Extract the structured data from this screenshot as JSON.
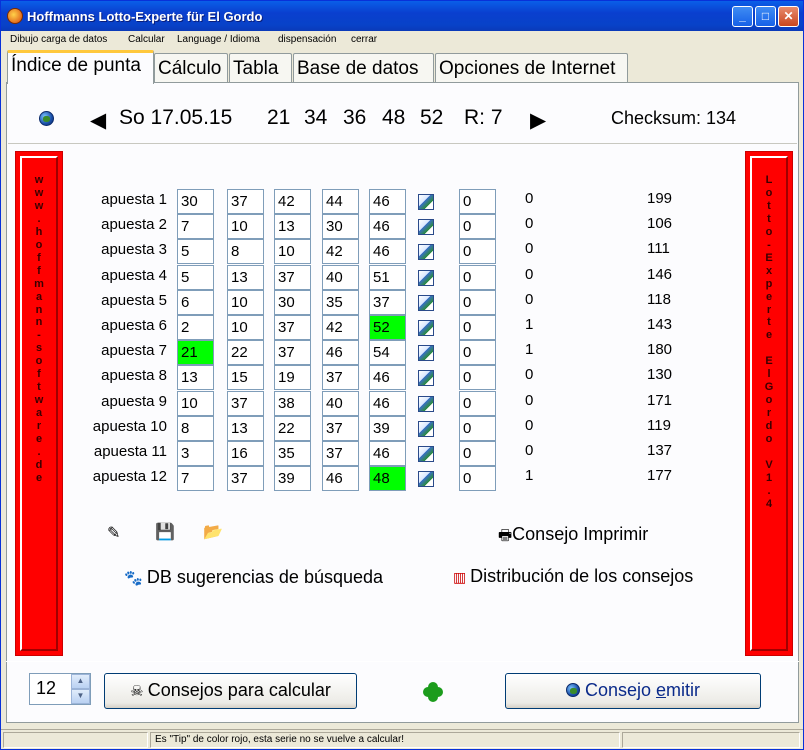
{
  "window": {
    "title": "Hoffmanns Lotto-Experte  für El Gordo",
    "min": "_",
    "max": "□",
    "close": "✕"
  },
  "menu": [
    "Dibujo carga de datos",
    "Calcular",
    "Language / Idioma",
    "dispensación",
    "cerrar"
  ],
  "tabs": [
    "Índice de punta",
    "Cálculo",
    "Tabla",
    "Base de datos",
    "Opciones de Internet"
  ],
  "draw": {
    "date": "So 17.05.15",
    "numbers": [
      "21",
      "34",
      "36",
      "48",
      "52"
    ],
    "r": "R: 7",
    "checksum": "Checksum: 134"
  },
  "left_sidebar": "www.hoffmann-software.de",
  "right_sidebar": "Lotto-Experte ElGordo V1.4",
  "bets": [
    {
      "label": "apuesta 1",
      "nums": [
        "30",
        "37",
        "42",
        "44",
        "46"
      ],
      "green": [],
      "field": "0",
      "hits": "0",
      "score": "199"
    },
    {
      "label": "apuesta 2",
      "nums": [
        "7",
        "10",
        "13",
        "30",
        "46"
      ],
      "green": [],
      "field": "0",
      "hits": "0",
      "score": "106"
    },
    {
      "label": "apuesta 3",
      "nums": [
        "5",
        "8",
        "10",
        "42",
        "46"
      ],
      "green": [],
      "field": "0",
      "hits": "0",
      "score": "111"
    },
    {
      "label": "apuesta 4",
      "nums": [
        "5",
        "13",
        "37",
        "40",
        "51"
      ],
      "green": [],
      "field": "0",
      "hits": "0",
      "score": "146"
    },
    {
      "label": "apuesta 5",
      "nums": [
        "6",
        "10",
        "30",
        "35",
        "37"
      ],
      "green": [],
      "field": "0",
      "hits": "0",
      "score": "118"
    },
    {
      "label": "apuesta 6",
      "nums": [
        "2",
        "10",
        "37",
        "42",
        "52"
      ],
      "green": [
        4
      ],
      "field": "0",
      "hits": "1",
      "score": "143"
    },
    {
      "label": "apuesta 7",
      "nums": [
        "21",
        "22",
        "37",
        "46",
        "54"
      ],
      "green": [
        0
      ],
      "field": "0",
      "hits": "1",
      "score": "180"
    },
    {
      "label": "apuesta 8",
      "nums": [
        "13",
        "15",
        "19",
        "37",
        "46"
      ],
      "green": [],
      "field": "0",
      "hits": "0",
      "score": "130"
    },
    {
      "label": "apuesta 9",
      "nums": [
        "10",
        "37",
        "38",
        "40",
        "46"
      ],
      "green": [],
      "field": "0",
      "hits": "0",
      "score": "171"
    },
    {
      "label": "apuesta 10",
      "nums": [
        "8",
        "13",
        "22",
        "37",
        "39"
      ],
      "green": [],
      "field": "0",
      "hits": "0",
      "score": "119"
    },
    {
      "label": "apuesta 11",
      "nums": [
        "3",
        "16",
        "35",
        "37",
        "46"
      ],
      "green": [],
      "field": "0",
      "hits": "0",
      "score": "137"
    },
    {
      "label": "apuesta 12",
      "nums": [
        "7",
        "37",
        "39",
        "46",
        "48"
      ],
      "green": [
        4
      ],
      "field": "0",
      "hits": "1",
      "score": "177"
    }
  ],
  "actions": {
    "print": "Consejo Imprimir",
    "db_search": "DB sugerencias de búsqueda",
    "distribution": "Distribución de los consejos"
  },
  "bottom": {
    "count": "12",
    "calc_button": "Consejos para calcular",
    "emit_button_pre": "Consejo ",
    "emit_button_ul": "e",
    "emit_button_post": "mitir"
  },
  "status": {
    "text": "Es \"Tip\" de color rojo, esta serie no se vuelve a calcular!"
  },
  "colors": {
    "match": "#00ff00",
    "sidebar": "#ff0000",
    "title_bar": "#0a3fcf"
  }
}
